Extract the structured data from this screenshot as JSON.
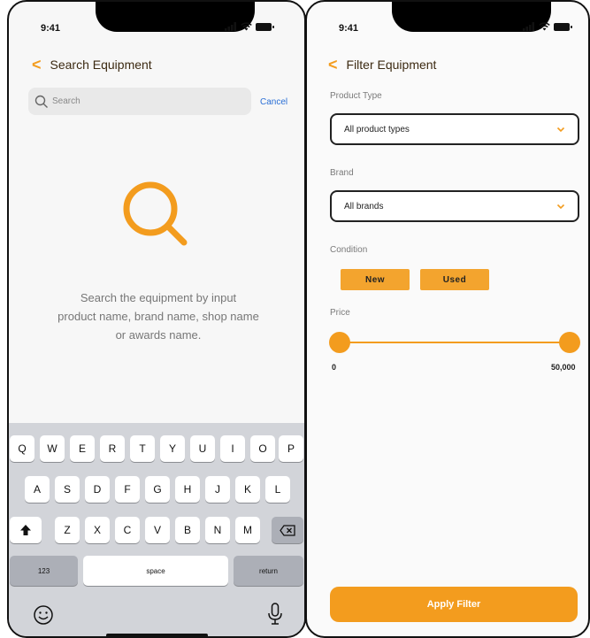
{
  "search_screen": {
    "status": {
      "time": "9:41"
    },
    "nav": {
      "back": "<",
      "title": "Search Equipment"
    },
    "search": {
      "placeholder": "Search",
      "cancel": "Cancel"
    },
    "empty_state": {
      "line1": "Search the equipment by input",
      "line2": "product name, brand name, shop name",
      "line3": "or awards name."
    },
    "keyboard": {
      "row1": [
        "Q",
        "W",
        "E",
        "R",
        "T",
        "Y",
        "U",
        "I",
        "O",
        "P"
      ],
      "row2": [
        "A",
        "S",
        "D",
        "F",
        "G",
        "H",
        "J",
        "K",
        "L"
      ],
      "row3": [
        "Z",
        "X",
        "C",
        "V",
        "B",
        "N",
        "M"
      ],
      "numbers": "123",
      "space": "space",
      "return": "return"
    }
  },
  "filter_screen": {
    "status": {
      "time": "9:41"
    },
    "nav": {
      "back": "<",
      "title": "Filter Equipment"
    },
    "product_type": {
      "label": "Product Type",
      "value": "All product types"
    },
    "brand": {
      "label": "Brand",
      "value": "All brands"
    },
    "condition": {
      "label": "Condition",
      "options": [
        "New",
        "Used"
      ]
    },
    "price": {
      "label": "Price",
      "min": "0",
      "max": "50,000"
    },
    "apply_label": "Apply Filter"
  },
  "colors": {
    "accent": "#f39c1e",
    "link": "#2a6fd6"
  }
}
